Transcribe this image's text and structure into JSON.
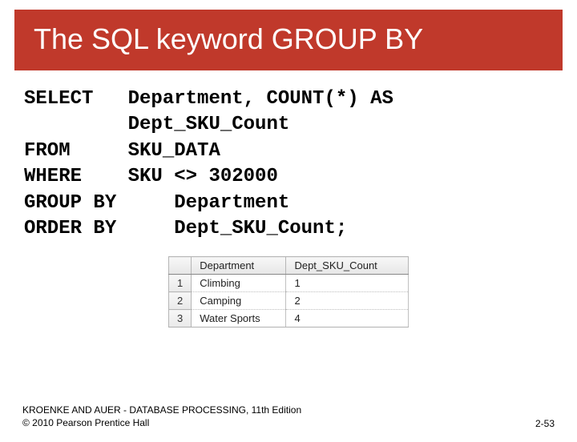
{
  "title": "The SQL keyword GROUP BY",
  "sql": {
    "line1": "SELECT   Department, COUNT(*) AS",
    "line2": "         Dept_SKU_Count",
    "line3": "FROM     SKU_DATA",
    "line4": "WHERE    SKU <> 302000",
    "line5": "GROUP BY     Department",
    "line6": "ORDER BY     Dept_SKU_Count;"
  },
  "result": {
    "headers": {
      "col1": "Department",
      "col2": "Dept_SKU_Count"
    },
    "rows": [
      {
        "n": "1",
        "dept": "Climbing",
        "cnt": "1"
      },
      {
        "n": "2",
        "dept": "Camping",
        "cnt": "2"
      },
      {
        "n": "3",
        "dept": "Water Sports",
        "cnt": "4"
      }
    ]
  },
  "footer": {
    "book": "KROENKE AND AUER - DATABASE PROCESSING, 11th Edition",
    "copyright": "© 2010 Pearson Prentice Hall",
    "page": "2-53"
  },
  "chart_data": {
    "type": "table",
    "title": "GROUP BY result",
    "columns": [
      "Department",
      "Dept_SKU_Count"
    ],
    "rows": [
      [
        "Climbing",
        1
      ],
      [
        "Camping",
        2
      ],
      [
        "Water Sports",
        4
      ]
    ]
  }
}
